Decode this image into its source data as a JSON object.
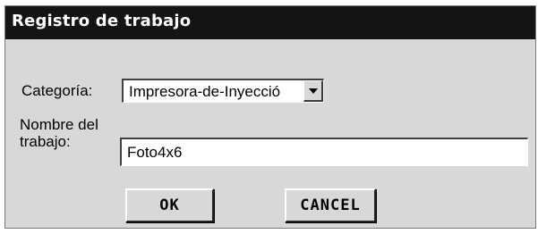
{
  "window": {
    "title": "Registro de trabajo"
  },
  "form": {
    "categoria_label": "Categoría:",
    "categoria_value": "Impresora-de-Inyecció",
    "nombre_label": "Nombre del trabajo:",
    "nombre_value": "Foto4x6"
  },
  "buttons": {
    "ok_label": "OK",
    "cancel_label": "CANCEL"
  },
  "icons": {
    "dropdown": "chevron-down-icon"
  }
}
